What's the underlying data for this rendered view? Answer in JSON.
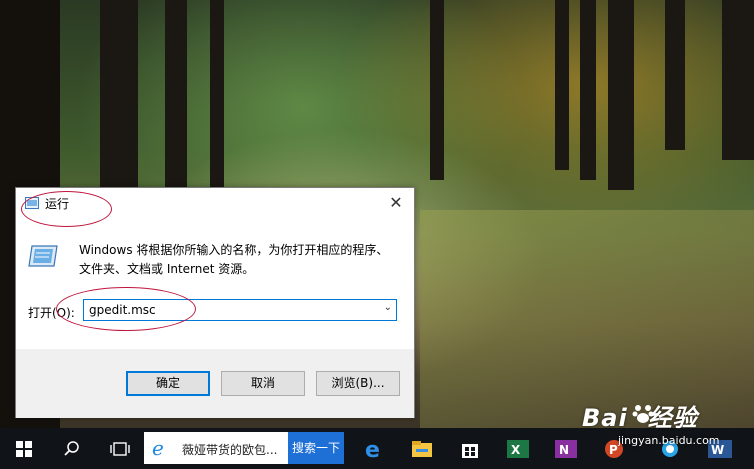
{
  "dialog": {
    "title": "运行",
    "description_line1": "Windows 将根据你所输入的名称，为你打开相应的程序、",
    "description_line2": "文件夹、文档或 Internet 资源。",
    "open_label": "打开(O):",
    "input_value": "gpedit.msc",
    "ok_label": "确定",
    "cancel_label": "取消",
    "browse_label": "浏览(B)...",
    "close_glyph": "✕"
  },
  "taskbar": {
    "search_text": "薇娅带货的欧包...",
    "search_button_label": "搜索一下",
    "apps": [
      "windows-start-icon",
      "search-icon",
      "task-view-icon",
      "edge-icon",
      "file-explorer-icon",
      "store-icon",
      "excel-icon",
      "onenote-icon",
      "powerpoint-icon",
      "chat-icon",
      "word-icon"
    ]
  },
  "watermark": {
    "brand": "Bai",
    "brand_cn": "经验",
    "url": "jingyan.baidu.com"
  },
  "colors": {
    "accent": "#0078d7",
    "annotation": "#c0143c",
    "taskbar": "#101418"
  }
}
